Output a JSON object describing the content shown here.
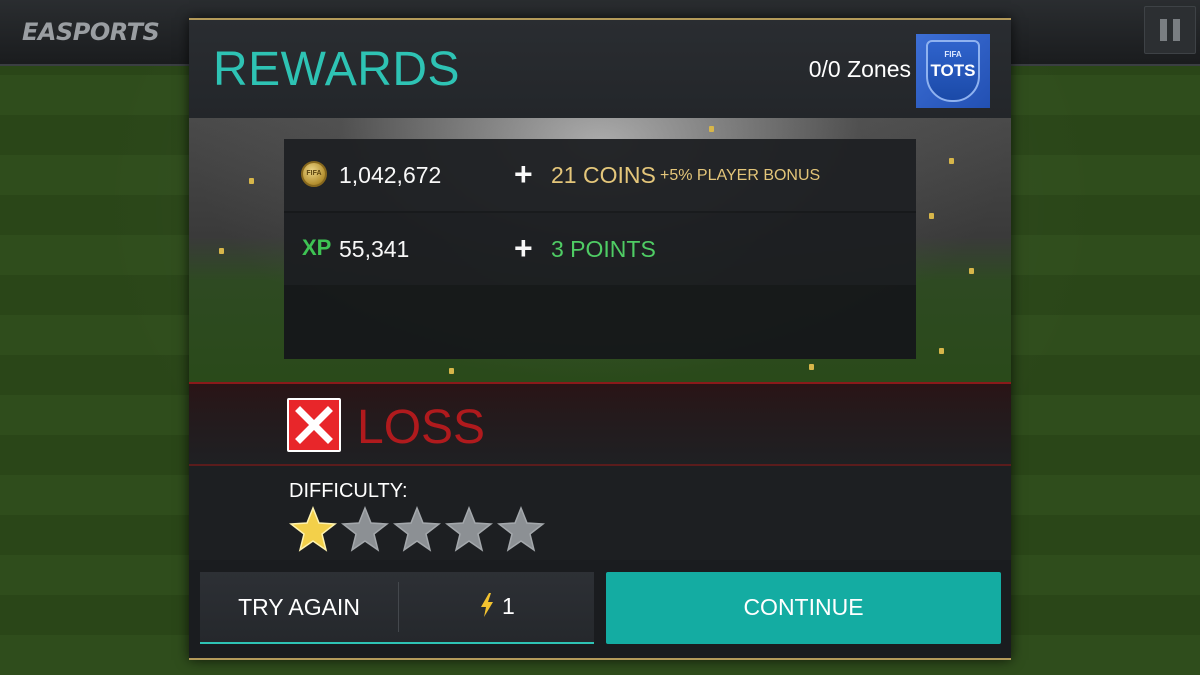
{
  "topbar": {
    "brand": "EASPORTS",
    "pause_icon": "pause-icon"
  },
  "modal": {
    "title": "REWARDS",
    "zones": "0/0 Zones",
    "badge": {
      "line1": "FIFA",
      "line2": "TOTS",
      "icon": "tots-badge-icon"
    },
    "rewards": {
      "coins": {
        "icon": "coin-icon",
        "icon_text": "FIFA",
        "total": "1,042,672",
        "gain": "21 COINS",
        "bonus": "+5% PLAYER BONUS"
      },
      "xp": {
        "icon_text": "XP",
        "total": "55,341",
        "gain": "3 POINTS"
      }
    },
    "result": {
      "icon": "x-icon",
      "text": "LOSS"
    },
    "difficulty": {
      "label": "DIFFICULTY:",
      "rating": 1,
      "max": 5
    },
    "buttons": {
      "try_again": "TRY AGAIN",
      "energy_cost": "1",
      "continue": "CONTINUE"
    }
  },
  "colors": {
    "accent_teal": "#2ec3b4",
    "loss_red": "#b01a1d",
    "coin_gold": "#e8c97a",
    "xp_green": "#4fd165"
  }
}
